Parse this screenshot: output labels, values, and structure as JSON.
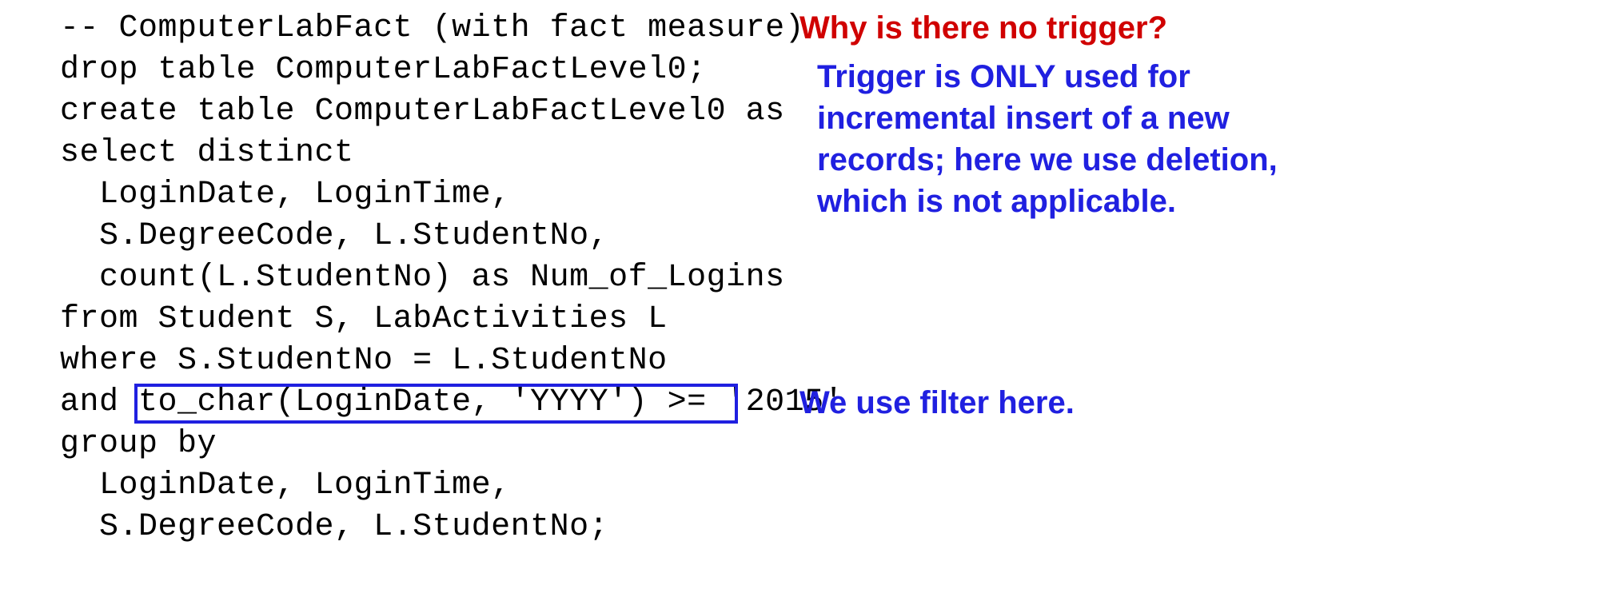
{
  "code": {
    "lines": [
      "-- ComputerLabFact (with fact measure)",
      "drop table ComputerLabFactLevel0;",
      "create table ComputerLabFactLevel0 as",
      "select distinct",
      "  LoginDate, LoginTime,",
      "  S.DegreeCode, L.StudentNo,",
      "  count(L.StudentNo) as Num_of_Logins",
      "from Student S, LabActivities L",
      "where S.StudentNo = L.StudentNo",
      "and to_char(LoginDate, 'YYYY') >= '2015'",
      "group by",
      "  LoginDate, LoginTime,",
      "  S.DegreeCode, L.StudentNo;"
    ]
  },
  "annotations": {
    "question": "Why is there no trigger?",
    "answer_line1": "Trigger is ONLY used for",
    "answer_line2": "incremental insert of a new",
    "answer_line3": "records; here we use deletion,",
    "answer_line4": "which is not applicable.",
    "filter_note": "We use filter here."
  }
}
